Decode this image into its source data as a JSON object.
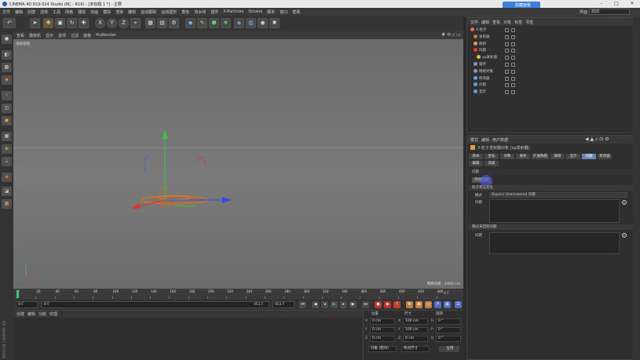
{
  "window": {
    "title": "CINEMA 4D R19.024 Studio (RC - R19) - [未标题 1 *] - 主要",
    "min": "–",
    "max": "□",
    "close": "✕"
  },
  "menubar": [
    "文件",
    "编辑",
    "创建",
    "选择",
    "工具",
    "网格",
    "捕捉",
    "动画",
    "模拟",
    "渲染",
    "雕刻",
    "运动跟踪",
    "运动图形",
    "角色",
    "流水线",
    "插件",
    "X-Particles",
    "Octane",
    "脚本",
    "窗口",
    "帮助"
  ],
  "top_right": {
    "layout_label": "界面",
    "layout_value": "启动",
    "overlay_button": "隐藏面板"
  },
  "toolbar": {
    "undo": "↶",
    "icons": [
      "cursor-icon",
      "move-icon",
      "scale-icon",
      "rotate-icon",
      "live-select-icon",
      "x-axis-icon",
      "y-axis-icon",
      "z-axis-icon",
      "coord-system-icon",
      "render-view-icon",
      "render-icon",
      "render-settings-icon",
      "cube-icon",
      "pen-icon",
      "subdivision-icon",
      "array-icon",
      "deformer-icon",
      "floor-icon",
      "camera-icon",
      "light-icon"
    ],
    "axis_x": "X",
    "axis_y": "Y",
    "axis_z": "Z"
  },
  "viewport": {
    "menu": [
      "查看",
      "摄像机",
      "显示",
      "选项",
      "过滤",
      "面板",
      "ProRender"
    ],
    "label": "透视视图",
    "grid_distance": "网格间距 : 1000 cm"
  },
  "timeline": {
    "ticks": [
      "0",
      "20",
      "40",
      "60",
      "80",
      "100",
      "120",
      "140",
      "160",
      "180",
      "200",
      "220",
      "240",
      "260",
      "280",
      "300",
      "320",
      "340",
      "360",
      "380",
      "400",
      "420",
      "440"
    ],
    "frame_end_label": "0 F"
  },
  "playbar": {
    "start": "0 F",
    "cur": "0 F",
    "end": "451 F",
    "end2": "451 F"
  },
  "materials": {
    "tabs": [
      "创建",
      "编辑",
      "功能",
      "纹理"
    ]
  },
  "coords": {
    "headers": [
      "位置",
      "尺寸",
      "旋转"
    ],
    "rows": [
      {
        "a": "X",
        "v1": "0 cm",
        "b": "X",
        "v2": "100 cm",
        "c": "H",
        "v3": "0 °"
      },
      {
        "a": "Y",
        "v1": "0 cm",
        "b": "Y",
        "v2": "100 cm",
        "c": "P",
        "v3": "0 °"
      },
      {
        "a": "Z",
        "v1": "0 cm",
        "b": "Z",
        "v2": "0 cm",
        "c": "B",
        "v3": "0 °"
      }
    ],
    "mode1": "对象 (相对)",
    "mode2": "绝对尺寸",
    "apply": "应用"
  },
  "maxon": "MAXON CINEMA 4D",
  "objects": {
    "menu": [
      "文件",
      "编辑",
      "查看",
      "对象",
      "标签",
      "书签"
    ],
    "items": [
      {
        "name": "X-粒子",
        "color": "#e07040",
        "indent": 0
      },
      {
        "name": "发射器",
        "color": "#e07040",
        "indent": 4
      },
      {
        "name": "群组",
        "color": "#e0a040",
        "indent": 4
      },
      {
        "name": "问题",
        "color": "#e04040",
        "indent": 4
      },
      {
        "name": "xp发射器",
        "color": "#e0c040",
        "indent": 8
      },
      {
        "name": "缓存",
        "color": "#9090c0",
        "indent": 4
      },
      {
        "name": "网格对象",
        "color": "#9090c0",
        "indent": 4
      },
      {
        "name": "修改器",
        "color": "#60a0e0",
        "indent": 4
      },
      {
        "name": "问题",
        "color": "#60a0e0",
        "indent": 4
      },
      {
        "name": "显示",
        "color": "#60a0e0",
        "indent": 4
      }
    ]
  },
  "attributes": {
    "menu": [
      "模式",
      "编辑",
      "用户数据"
    ],
    "title": "X-粒子发射器对象 [xp发射器]",
    "tabs": [
      "基本",
      "坐标",
      "对象",
      "发射",
      "扩展数据",
      "群组",
      "显示",
      "问题",
      "修改器",
      "编辑",
      "高级"
    ],
    "active_tab": "问题",
    "section_header": "问题",
    "button": "添加问题",
    "section1": "粒子状态变化",
    "mode_label": "模式",
    "mode_value": "Bypass Unanswered 问题",
    "list_label": "问题",
    "section2": "跳过未回答问题",
    "list2_label": "问题"
  },
  "colors": {
    "accent": "#6b84b0",
    "axis_y": "#40c040",
    "axis_x": "#e03030",
    "axis_z": "#3050e0",
    "emitter": "#e07020"
  }
}
